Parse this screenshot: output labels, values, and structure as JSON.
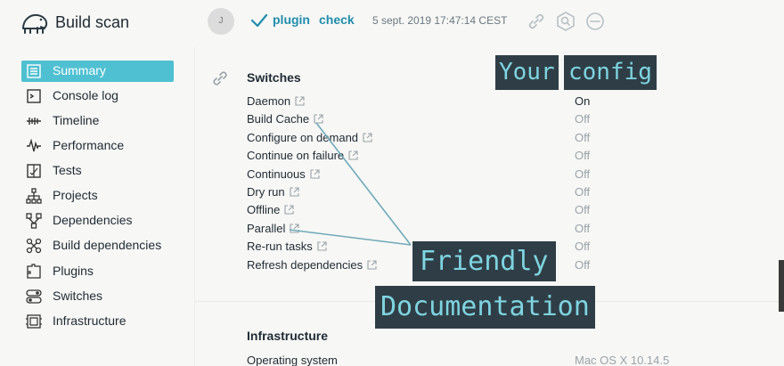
{
  "header": {
    "brand": "Build scan",
    "avatar_initial": "J",
    "tasks": [
      "plugin",
      "check"
    ],
    "timestamp": "5 sept. 2019 17:47:14 CEST",
    "icons": [
      "link-icon",
      "search-icon",
      "minus-circle-icon"
    ]
  },
  "sidebar": {
    "items": [
      {
        "label": "Summary",
        "icon": "summary-icon",
        "active": true
      },
      {
        "label": "Console log",
        "icon": "console-icon"
      },
      {
        "label": "Timeline",
        "icon": "timeline-icon"
      },
      {
        "label": "Performance",
        "icon": "performance-icon"
      },
      {
        "label": "Tests",
        "icon": "tests-icon"
      },
      {
        "label": "Projects",
        "icon": "projects-icon"
      },
      {
        "label": "Dependencies",
        "icon": "dependencies-icon"
      },
      {
        "label": "Build dependencies",
        "icon": "build-dependencies-icon"
      },
      {
        "label": "Plugins",
        "icon": "plugins-icon"
      },
      {
        "label": "Switches",
        "icon": "switches-icon"
      },
      {
        "label": "Infrastructure",
        "icon": "infrastructure-icon"
      }
    ]
  },
  "switches": {
    "title": "Switches",
    "rows": [
      {
        "label": "Daemon",
        "value": "On"
      },
      {
        "label": "Build Cache",
        "value": "Off"
      },
      {
        "label": "Configure on demand",
        "value": "Off"
      },
      {
        "label": "Continue on failure",
        "value": "Off"
      },
      {
        "label": "Continuous",
        "value": "Off"
      },
      {
        "label": "Dry run",
        "value": "Off"
      },
      {
        "label": "Offline",
        "value": "Off"
      },
      {
        "label": "Parallel",
        "value": "Off"
      },
      {
        "label": "Re-run tasks",
        "value": "Off"
      },
      {
        "label": "Refresh dependencies",
        "value": "Off"
      }
    ]
  },
  "infrastructure": {
    "title": "Infrastructure",
    "os_label": "Operating system",
    "os_value": "Mac OS X 10.14.5"
  },
  "annotations": {
    "your": "Your",
    "config": "config",
    "friendly": "Friendly",
    "documentation": "Documentation"
  },
  "colors": {
    "accent": "#4fc0d1",
    "link": "#1f8dad",
    "callout_bg": "#2f3e46",
    "callout_text": "#7ed4e0"
  }
}
